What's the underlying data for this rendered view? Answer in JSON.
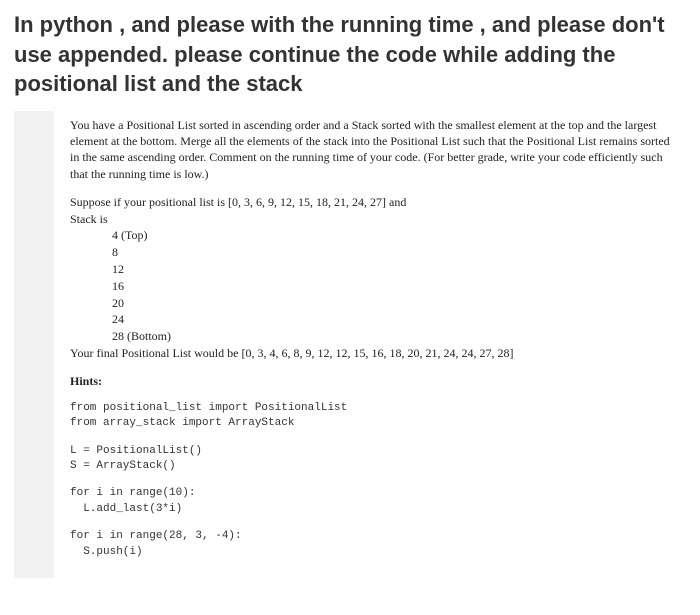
{
  "title": "In python , and please with the running time , and please don't use appended. please continue the code while adding the positional list and the stack",
  "problem": "You have a Positional List sorted in ascending order and a Stack sorted with the smallest element at the top and the largest element at the bottom. Merge all the elements of the stack into the Positional List such that the Positional List remains sorted in the same ascending order. Comment on the running time of your code. (For better grade, write your code efficiently such that the running time is low.)",
  "example": {
    "intro": "Suppose if your positional list is [0, 3, 6, 9, 12, 15, 18, 21, 24, 27] and",
    "stack_label": "Stack is",
    "stack_rows": [
      "4 (Top)",
      "8",
      "12",
      "16",
      "20",
      "24",
      "28 (Bottom)"
    ],
    "result": "Your final Positional List would be [0, 3, 4, 6, 8, 9, 12, 12, 15, 16, 18, 20, 21, 24, 24, 27, 28]"
  },
  "hints_label": "Hints:",
  "code": {
    "imports": "from positional_list import PositionalList\nfrom array_stack import ArrayStack",
    "init": "L = PositionalList()\nS = ArrayStack()",
    "loop1": "for i in range(10):\n  L.add_last(3*i)",
    "loop2": "for i in range(28, 3, -4):\n  S.push(i)"
  }
}
